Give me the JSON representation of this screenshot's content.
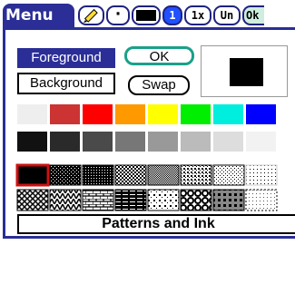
{
  "menubar": {
    "menu_label": "Menu",
    "tool_dot": "·",
    "tool_one": "1",
    "tool_zoom": "1x",
    "tool_undo": "Un",
    "tool_ok": "Ok"
  },
  "dialog": {
    "foreground_label": "Foreground",
    "background_label": "Background",
    "ok_label": "OK",
    "swap_label": "Swap",
    "status_text": "Patterns and Ink"
  },
  "colors": {
    "accent": "#2a2e96",
    "preview": "#000000",
    "row1": [
      "#eeeeee",
      "#cc3333",
      "#ff0000",
      "#ff9900",
      "#ffff00",
      "#00ee00",
      "#00eedd",
      "#0000ff"
    ],
    "row2": [
      "#111111",
      "#2a2a2a",
      "#4a4a4a",
      "#777777",
      "#999999",
      "#bbbbbb",
      "#dddddd",
      "#f2f2f2"
    ]
  }
}
